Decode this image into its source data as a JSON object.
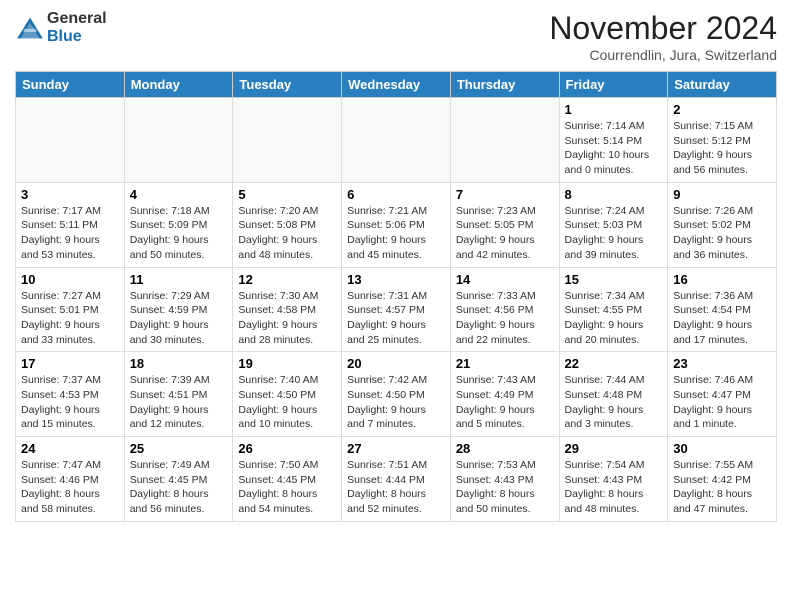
{
  "header": {
    "logo_general": "General",
    "logo_blue": "Blue",
    "month_title": "November 2024",
    "subtitle": "Courrendlin, Jura, Switzerland"
  },
  "columns": [
    "Sunday",
    "Monday",
    "Tuesday",
    "Wednesday",
    "Thursday",
    "Friday",
    "Saturday"
  ],
  "weeks": [
    [
      {
        "day": "",
        "info": "",
        "empty": true
      },
      {
        "day": "",
        "info": "",
        "empty": true
      },
      {
        "day": "",
        "info": "",
        "empty": true
      },
      {
        "day": "",
        "info": "",
        "empty": true
      },
      {
        "day": "",
        "info": "",
        "empty": true
      },
      {
        "day": "1",
        "info": "Sunrise: 7:14 AM\nSunset: 5:14 PM\nDaylight: 10 hours and 0 minutes.",
        "empty": false
      },
      {
        "day": "2",
        "info": "Sunrise: 7:15 AM\nSunset: 5:12 PM\nDaylight: 9 hours and 56 minutes.",
        "empty": false
      }
    ],
    [
      {
        "day": "3",
        "info": "Sunrise: 7:17 AM\nSunset: 5:11 PM\nDaylight: 9 hours and 53 minutes.",
        "empty": false
      },
      {
        "day": "4",
        "info": "Sunrise: 7:18 AM\nSunset: 5:09 PM\nDaylight: 9 hours and 50 minutes.",
        "empty": false
      },
      {
        "day": "5",
        "info": "Sunrise: 7:20 AM\nSunset: 5:08 PM\nDaylight: 9 hours and 48 minutes.",
        "empty": false
      },
      {
        "day": "6",
        "info": "Sunrise: 7:21 AM\nSunset: 5:06 PM\nDaylight: 9 hours and 45 minutes.",
        "empty": false
      },
      {
        "day": "7",
        "info": "Sunrise: 7:23 AM\nSunset: 5:05 PM\nDaylight: 9 hours and 42 minutes.",
        "empty": false
      },
      {
        "day": "8",
        "info": "Sunrise: 7:24 AM\nSunset: 5:03 PM\nDaylight: 9 hours and 39 minutes.",
        "empty": false
      },
      {
        "day": "9",
        "info": "Sunrise: 7:26 AM\nSunset: 5:02 PM\nDaylight: 9 hours and 36 minutes.",
        "empty": false
      }
    ],
    [
      {
        "day": "10",
        "info": "Sunrise: 7:27 AM\nSunset: 5:01 PM\nDaylight: 9 hours and 33 minutes.",
        "empty": false
      },
      {
        "day": "11",
        "info": "Sunrise: 7:29 AM\nSunset: 4:59 PM\nDaylight: 9 hours and 30 minutes.",
        "empty": false
      },
      {
        "day": "12",
        "info": "Sunrise: 7:30 AM\nSunset: 4:58 PM\nDaylight: 9 hours and 28 minutes.",
        "empty": false
      },
      {
        "day": "13",
        "info": "Sunrise: 7:31 AM\nSunset: 4:57 PM\nDaylight: 9 hours and 25 minutes.",
        "empty": false
      },
      {
        "day": "14",
        "info": "Sunrise: 7:33 AM\nSunset: 4:56 PM\nDaylight: 9 hours and 22 minutes.",
        "empty": false
      },
      {
        "day": "15",
        "info": "Sunrise: 7:34 AM\nSunset: 4:55 PM\nDaylight: 9 hours and 20 minutes.",
        "empty": false
      },
      {
        "day": "16",
        "info": "Sunrise: 7:36 AM\nSunset: 4:54 PM\nDaylight: 9 hours and 17 minutes.",
        "empty": false
      }
    ],
    [
      {
        "day": "17",
        "info": "Sunrise: 7:37 AM\nSunset: 4:53 PM\nDaylight: 9 hours and 15 minutes.",
        "empty": false
      },
      {
        "day": "18",
        "info": "Sunrise: 7:39 AM\nSunset: 4:51 PM\nDaylight: 9 hours and 12 minutes.",
        "empty": false
      },
      {
        "day": "19",
        "info": "Sunrise: 7:40 AM\nSunset: 4:50 PM\nDaylight: 9 hours and 10 minutes.",
        "empty": false
      },
      {
        "day": "20",
        "info": "Sunrise: 7:42 AM\nSunset: 4:50 PM\nDaylight: 9 hours and 7 minutes.",
        "empty": false
      },
      {
        "day": "21",
        "info": "Sunrise: 7:43 AM\nSunset: 4:49 PM\nDaylight: 9 hours and 5 minutes.",
        "empty": false
      },
      {
        "day": "22",
        "info": "Sunrise: 7:44 AM\nSunset: 4:48 PM\nDaylight: 9 hours and 3 minutes.",
        "empty": false
      },
      {
        "day": "23",
        "info": "Sunrise: 7:46 AM\nSunset: 4:47 PM\nDaylight: 9 hours and 1 minute.",
        "empty": false
      }
    ],
    [
      {
        "day": "24",
        "info": "Sunrise: 7:47 AM\nSunset: 4:46 PM\nDaylight: 8 hours and 58 minutes.",
        "empty": false
      },
      {
        "day": "25",
        "info": "Sunrise: 7:49 AM\nSunset: 4:45 PM\nDaylight: 8 hours and 56 minutes.",
        "empty": false
      },
      {
        "day": "26",
        "info": "Sunrise: 7:50 AM\nSunset: 4:45 PM\nDaylight: 8 hours and 54 minutes.",
        "empty": false
      },
      {
        "day": "27",
        "info": "Sunrise: 7:51 AM\nSunset: 4:44 PM\nDaylight: 8 hours and 52 minutes.",
        "empty": false
      },
      {
        "day": "28",
        "info": "Sunrise: 7:53 AM\nSunset: 4:43 PM\nDaylight: 8 hours and 50 minutes.",
        "empty": false
      },
      {
        "day": "29",
        "info": "Sunrise: 7:54 AM\nSunset: 4:43 PM\nDaylight: 8 hours and 48 minutes.",
        "empty": false
      },
      {
        "day": "30",
        "info": "Sunrise: 7:55 AM\nSunset: 4:42 PM\nDaylight: 8 hours and 47 minutes.",
        "empty": false
      }
    ]
  ]
}
